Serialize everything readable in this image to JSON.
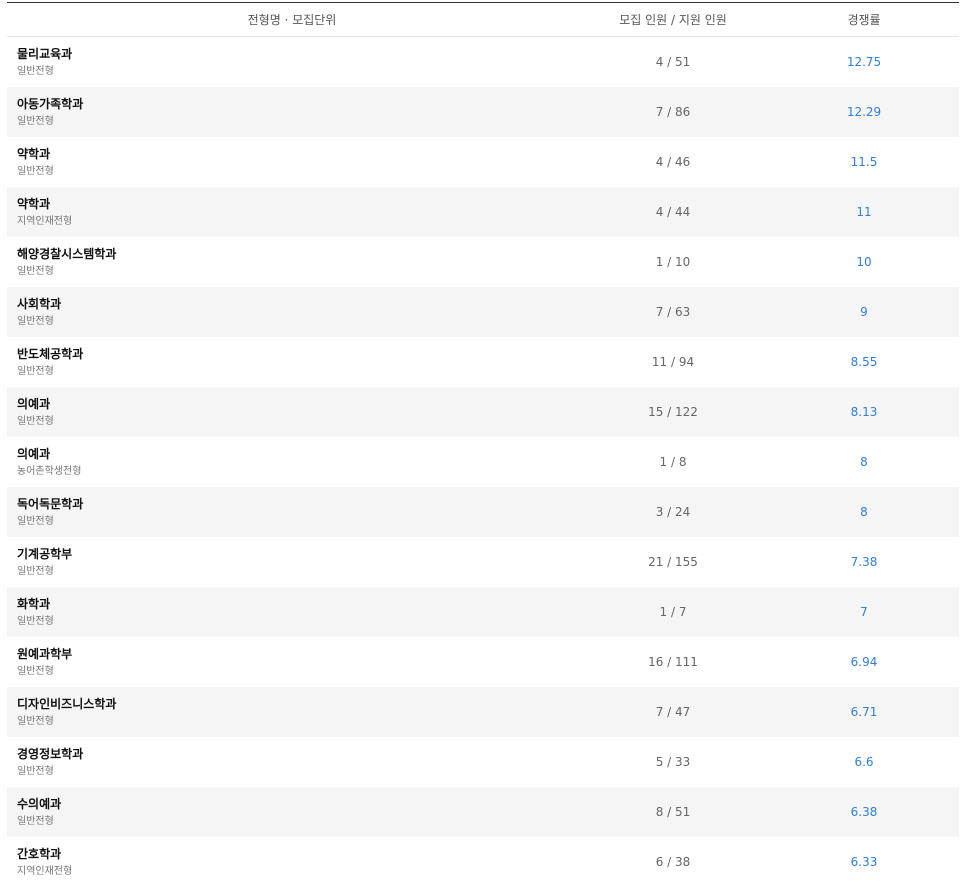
{
  "header": {
    "col_name": "전형명 · 모집단위",
    "col_count": "모집 인원  /  지원 인원",
    "col_rate": "경쟁률"
  },
  "colors": {
    "rate": "#2f7fd8",
    "row_alt": "#f5f5f5",
    "header_border": "#333333"
  },
  "rows": [
    {
      "dept": "물리교육과",
      "type": "일반전형",
      "count": "4 / 51",
      "rate": "12.75"
    },
    {
      "dept": "아동가족학과",
      "type": "일반전형",
      "count": "7 / 86",
      "rate": "12.29"
    },
    {
      "dept": "약학과",
      "type": "일반전형",
      "count": "4 / 46",
      "rate": "11.5"
    },
    {
      "dept": "약학과",
      "type": "지역인재전형",
      "count": "4 / 44",
      "rate": "11"
    },
    {
      "dept": "해양경찰시스템학과",
      "type": "일반전형",
      "count": "1 / 10",
      "rate": "10"
    },
    {
      "dept": "사회학과",
      "type": "일반전형",
      "count": "7 / 63",
      "rate": "9"
    },
    {
      "dept": "반도체공학과",
      "type": "일반전형",
      "count": "11 / 94",
      "rate": "8.55"
    },
    {
      "dept": "의예과",
      "type": "일반전형",
      "count": "15 / 122",
      "rate": "8.13"
    },
    {
      "dept": "의예과",
      "type": "농어촌학생전형",
      "count": "1 / 8",
      "rate": "8"
    },
    {
      "dept": "독어독문학과",
      "type": "일반전형",
      "count": "3 / 24",
      "rate": "8"
    },
    {
      "dept": "기계공학부",
      "type": "일반전형",
      "count": "21 / 155",
      "rate": "7.38"
    },
    {
      "dept": "화학과",
      "type": "일반전형",
      "count": "1 / 7",
      "rate": "7"
    },
    {
      "dept": "원예과학부",
      "type": "일반전형",
      "count": "16 / 111",
      "rate": "6.94"
    },
    {
      "dept": "디자인비즈니스학과",
      "type": "일반전형",
      "count": "7 / 47",
      "rate": "6.71"
    },
    {
      "dept": "경영정보학과",
      "type": "일반전형",
      "count": "5 / 33",
      "rate": "6.6"
    },
    {
      "dept": "수의예과",
      "type": "일반전형",
      "count": "8 / 51",
      "rate": "6.38"
    },
    {
      "dept": "간호학과",
      "type": "지역인재전형",
      "count": "6 / 38",
      "rate": "6.33"
    }
  ]
}
